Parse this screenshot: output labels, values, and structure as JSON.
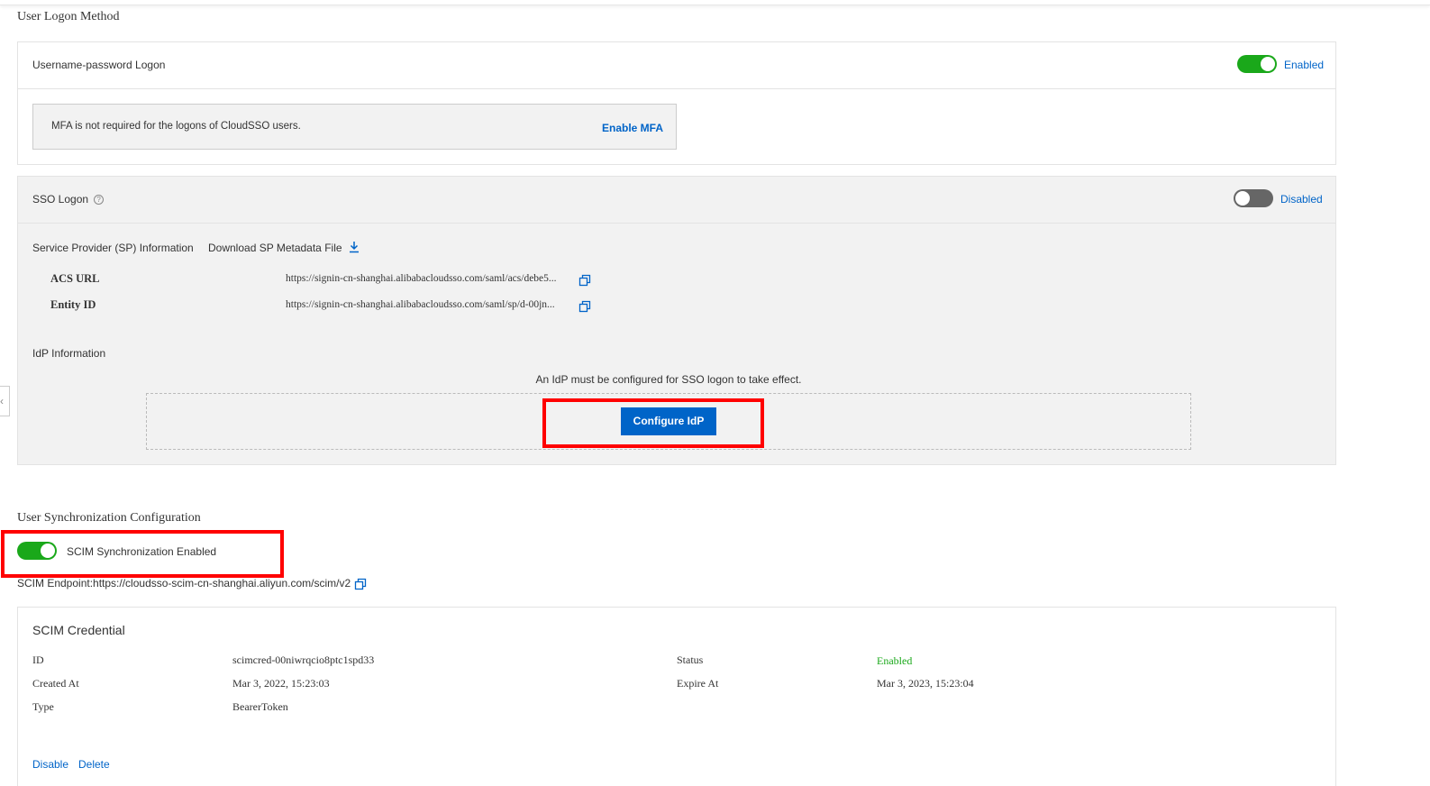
{
  "user_logon": {
    "title": "User Logon Method",
    "username_password": {
      "title": "Username-password Logon",
      "state": "Enabled",
      "mfa_message": "MFA is not required for the logons of CloudSSO users.",
      "enable_mfa": "Enable MFA"
    },
    "sso": {
      "title": "SSO Logon",
      "state": "Disabled",
      "sp_info_label": "Service Provider (SP) Information",
      "download_label": "Download SP Metadata File",
      "acs_url_label": "ACS URL",
      "acs_url_value": "https://signin-cn-shanghai.alibabacloudsso.com/saml/acs/debe5...",
      "entity_id_label": "Entity ID",
      "entity_id_value": "https://signin-cn-shanghai.alibabacloudsso.com/saml/sp/d-00jn...",
      "idp_info_label": "IdP Information",
      "idp_notice": "An IdP must be configured for SSO logon to take effect.",
      "configure_button": "Configure IdP"
    }
  },
  "user_sync": {
    "title": "User Synchronization Configuration",
    "scim_toggle_label": "SCIM Synchronization Enabled",
    "scim_endpoint": "SCIM Endpoint:https://cloudsso-scim-cn-shanghai.aliyun.com/scim/v2"
  },
  "scim_credential": {
    "title": "SCIM Credential",
    "id_label": "ID",
    "id_value": "scimcred-00niwrqcio8ptc1spd33",
    "created_label": "Created At",
    "created_value": "Mar 3, 2022, 15:23:03",
    "type_label": "Type",
    "type_value": "BearerToken",
    "status_label": "Status",
    "status_value": "Enabled",
    "expire_label": "Expire At",
    "expire_value": "Mar 3, 2023, 15:23:04",
    "disable_link": "Disable",
    "delete_link": "Delete"
  },
  "colors": {
    "link": "#0064c8",
    "toggle_on": "#1aa81a",
    "toggle_off": "#666666",
    "highlight": "#ff0000"
  }
}
